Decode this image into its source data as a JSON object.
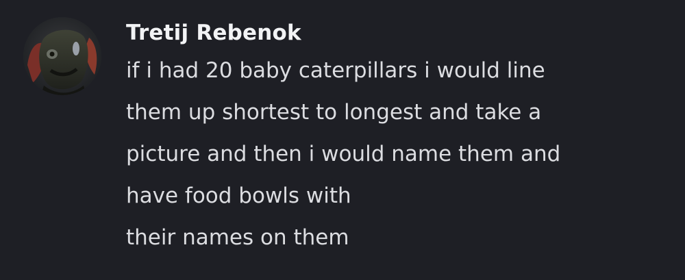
{
  "message": {
    "author": "Tretij Rebenok",
    "avatar_icon": "user-avatar-icon",
    "lines": [
      "if i had 20 baby caterpillars i would line",
      "them up shortest to longest and take a",
      "picture and then i would name them and",
      "have food bowls with",
      "their names on them"
    ]
  },
  "colors": {
    "background": "#1e1f25",
    "username": "#f2f3f5",
    "text": "#dcdde1"
  }
}
